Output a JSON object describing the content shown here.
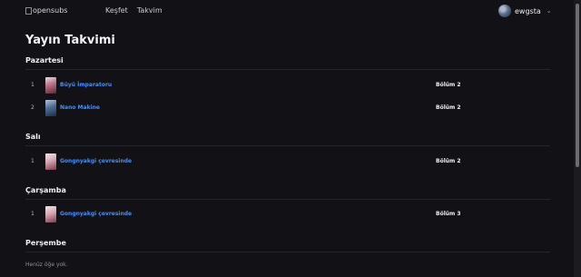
{
  "nav": {
    "logo_alt": "opensubs",
    "links": [
      "Keşfet",
      "Takvim"
    ],
    "username": "ewgsta",
    "chevron": "⌄"
  },
  "page_title": "Yayın Takvimi",
  "days": [
    {
      "name": "Pazartesi",
      "items": [
        {
          "index": "1",
          "title": "Büyü İmparatoru",
          "episode": "Bölüm 2"
        },
        {
          "index": "2",
          "title": "Nano Makine",
          "episode": "Bölüm 2"
        }
      ]
    },
    {
      "name": "Salı",
      "items": [
        {
          "index": "1",
          "title": "Gongnyakgi çevresinde",
          "episode": "Bölüm 2"
        }
      ]
    },
    {
      "name": "Çarşamba",
      "items": [
        {
          "index": "1",
          "title": "Gongnyakgi çevresinde",
          "episode": "Bölüm 3"
        }
      ]
    },
    {
      "name": "Perşembe",
      "empty_text": "Henüz öğe yok."
    }
  ]
}
